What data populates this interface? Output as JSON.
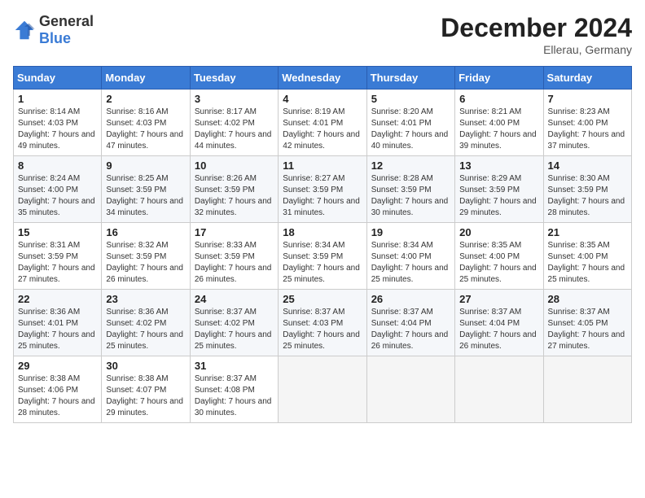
{
  "header": {
    "logo_general": "General",
    "logo_blue": "Blue",
    "month_year": "December 2024",
    "location": "Ellerau, Germany"
  },
  "weekdays": [
    "Sunday",
    "Monday",
    "Tuesday",
    "Wednesday",
    "Thursday",
    "Friday",
    "Saturday"
  ],
  "weeks": [
    [
      {
        "day": "1",
        "sunrise": "8:14 AM",
        "sunset": "4:03 PM",
        "daylight": "7 hours and 49 minutes."
      },
      {
        "day": "2",
        "sunrise": "8:16 AM",
        "sunset": "4:03 PM",
        "daylight": "7 hours and 47 minutes."
      },
      {
        "day": "3",
        "sunrise": "8:17 AM",
        "sunset": "4:02 PM",
        "daylight": "7 hours and 44 minutes."
      },
      {
        "day": "4",
        "sunrise": "8:19 AM",
        "sunset": "4:01 PM",
        "daylight": "7 hours and 42 minutes."
      },
      {
        "day": "5",
        "sunrise": "8:20 AM",
        "sunset": "4:01 PM",
        "daylight": "7 hours and 40 minutes."
      },
      {
        "day": "6",
        "sunrise": "8:21 AM",
        "sunset": "4:00 PM",
        "daylight": "7 hours and 39 minutes."
      },
      {
        "day": "7",
        "sunrise": "8:23 AM",
        "sunset": "4:00 PM",
        "daylight": "7 hours and 37 minutes."
      }
    ],
    [
      {
        "day": "8",
        "sunrise": "8:24 AM",
        "sunset": "4:00 PM",
        "daylight": "7 hours and 35 minutes."
      },
      {
        "day": "9",
        "sunrise": "8:25 AM",
        "sunset": "3:59 PM",
        "daylight": "7 hours and 34 minutes."
      },
      {
        "day": "10",
        "sunrise": "8:26 AM",
        "sunset": "3:59 PM",
        "daylight": "7 hours and 32 minutes."
      },
      {
        "day": "11",
        "sunrise": "8:27 AM",
        "sunset": "3:59 PM",
        "daylight": "7 hours and 31 minutes."
      },
      {
        "day": "12",
        "sunrise": "8:28 AM",
        "sunset": "3:59 PM",
        "daylight": "7 hours and 30 minutes."
      },
      {
        "day": "13",
        "sunrise": "8:29 AM",
        "sunset": "3:59 PM",
        "daylight": "7 hours and 29 minutes."
      },
      {
        "day": "14",
        "sunrise": "8:30 AM",
        "sunset": "3:59 PM",
        "daylight": "7 hours and 28 minutes."
      }
    ],
    [
      {
        "day": "15",
        "sunrise": "8:31 AM",
        "sunset": "3:59 PM",
        "daylight": "7 hours and 27 minutes."
      },
      {
        "day": "16",
        "sunrise": "8:32 AM",
        "sunset": "3:59 PM",
        "daylight": "7 hours and 26 minutes."
      },
      {
        "day": "17",
        "sunrise": "8:33 AM",
        "sunset": "3:59 PM",
        "daylight": "7 hours and 26 minutes."
      },
      {
        "day": "18",
        "sunrise": "8:34 AM",
        "sunset": "3:59 PM",
        "daylight": "7 hours and 25 minutes."
      },
      {
        "day": "19",
        "sunrise": "8:34 AM",
        "sunset": "4:00 PM",
        "daylight": "7 hours and 25 minutes."
      },
      {
        "day": "20",
        "sunrise": "8:35 AM",
        "sunset": "4:00 PM",
        "daylight": "7 hours and 25 minutes."
      },
      {
        "day": "21",
        "sunrise": "8:35 AM",
        "sunset": "4:00 PM",
        "daylight": "7 hours and 25 minutes."
      }
    ],
    [
      {
        "day": "22",
        "sunrise": "8:36 AM",
        "sunset": "4:01 PM",
        "daylight": "7 hours and 25 minutes."
      },
      {
        "day": "23",
        "sunrise": "8:36 AM",
        "sunset": "4:02 PM",
        "daylight": "7 hours and 25 minutes."
      },
      {
        "day": "24",
        "sunrise": "8:37 AM",
        "sunset": "4:02 PM",
        "daylight": "7 hours and 25 minutes."
      },
      {
        "day": "25",
        "sunrise": "8:37 AM",
        "sunset": "4:03 PM",
        "daylight": "7 hours and 25 minutes."
      },
      {
        "day": "26",
        "sunrise": "8:37 AM",
        "sunset": "4:04 PM",
        "daylight": "7 hours and 26 minutes."
      },
      {
        "day": "27",
        "sunrise": "8:37 AM",
        "sunset": "4:04 PM",
        "daylight": "7 hours and 26 minutes."
      },
      {
        "day": "28",
        "sunrise": "8:37 AM",
        "sunset": "4:05 PM",
        "daylight": "7 hours and 27 minutes."
      }
    ],
    [
      {
        "day": "29",
        "sunrise": "8:38 AM",
        "sunset": "4:06 PM",
        "daylight": "7 hours and 28 minutes."
      },
      {
        "day": "30",
        "sunrise": "8:38 AM",
        "sunset": "4:07 PM",
        "daylight": "7 hours and 29 minutes."
      },
      {
        "day": "31",
        "sunrise": "8:37 AM",
        "sunset": "4:08 PM",
        "daylight": "7 hours and 30 minutes."
      },
      null,
      null,
      null,
      null
    ]
  ]
}
